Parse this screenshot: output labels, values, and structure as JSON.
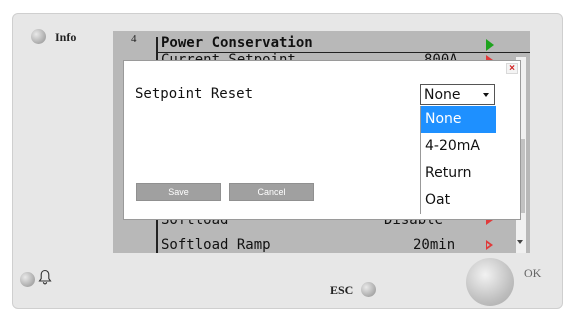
{
  "device": {
    "info_label": "Info",
    "esc_label": "ESC",
    "ok_label": "OK"
  },
  "screen": {
    "page_number": "4",
    "title": "Power Conservation",
    "rows": [
      {
        "label": "Current Setpoint",
        "value": "800A"
      },
      {
        "label": "Softload",
        "value": "Disable"
      },
      {
        "label": "Softload Ramp",
        "value": "20min"
      }
    ]
  },
  "dialog": {
    "close_glyph": "×",
    "field_label": "Setpoint Reset",
    "select_value": "None",
    "options": [
      "None",
      "4-20mA",
      "Return",
      "Oat"
    ],
    "save_label": "Save",
    "cancel_label": "Cancel"
  },
  "colors": {
    "highlight": "#1e90ff",
    "nav_arrow": "#1ea31e",
    "value_arrow": "#e03a3a"
  }
}
